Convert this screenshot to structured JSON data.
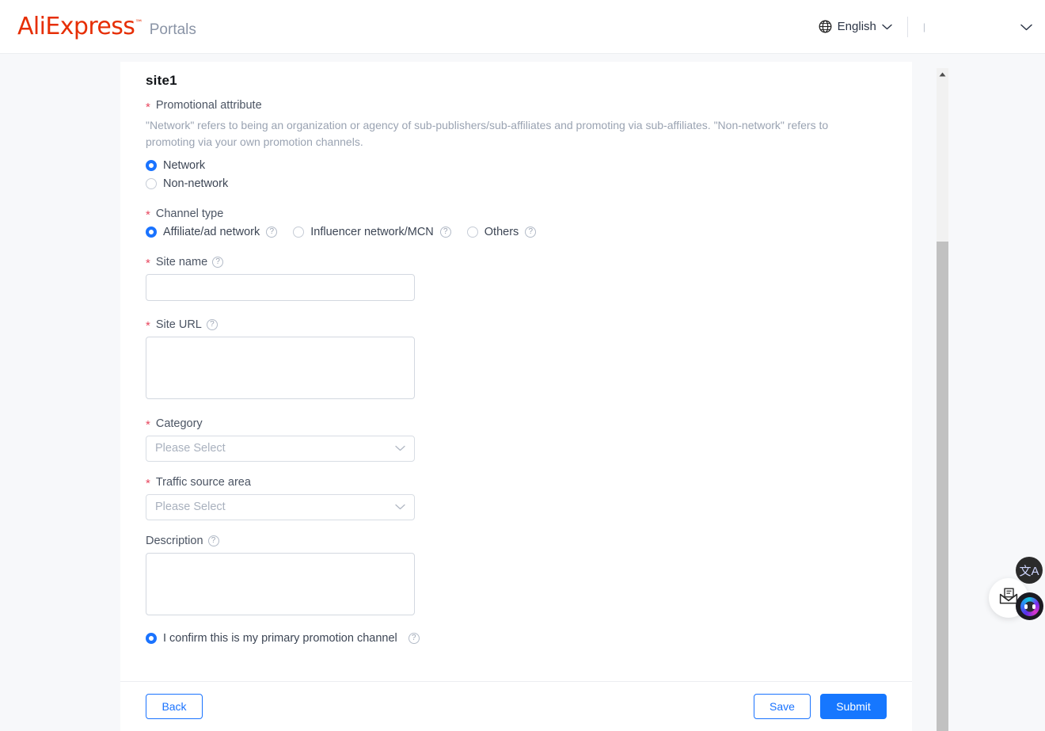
{
  "header": {
    "brand_main": "AliExpress",
    "brand_tm": "™",
    "brand_sub": "Portals",
    "language": "English",
    "globe_icon": "globe-icon",
    "lang_chevron_icon": "chevron-down-icon",
    "account_stub": "|",
    "account_chevron_icon": "chevron-down-icon"
  },
  "form": {
    "site_title": "site1",
    "promotional_attribute": {
      "required_mark": "*",
      "label": "Promotional attribute",
      "description": "\"Network\" refers to being an organization or agency of sub-publishers/sub-affiliates and promoting via sub-affiliates. \"Non-network\" refers to promoting via your own promotion channels.",
      "options": [
        {
          "label": "Network",
          "selected": true
        },
        {
          "label": "Non-network",
          "selected": false
        }
      ]
    },
    "channel_type": {
      "required_mark": "*",
      "label": "Channel type",
      "options": [
        {
          "label": "Affiliate/ad network",
          "selected": true,
          "help": "?"
        },
        {
          "label": "Influencer network/MCN",
          "selected": false,
          "help": "?"
        },
        {
          "label": "Others",
          "selected": false,
          "help": "?"
        }
      ]
    },
    "site_name": {
      "required_mark": "*",
      "label": "Site name",
      "help": "?",
      "value": "",
      "placeholder": ""
    },
    "site_url": {
      "required_mark": "*",
      "label": "Site URL",
      "help": "?",
      "value": "",
      "placeholder": ""
    },
    "category": {
      "required_mark": "*",
      "label": "Category",
      "selected": "Please Select",
      "chevron_icon": "chevron-down-icon"
    },
    "traffic_source_area": {
      "required_mark": "*",
      "label": "Traffic source area",
      "selected": "Please Select",
      "chevron_icon": "chevron-down-icon"
    },
    "description": {
      "label": "Description",
      "help": "?",
      "value": "",
      "placeholder": ""
    },
    "confirm": {
      "label": "I confirm this is my primary promotion channel",
      "selected": true,
      "help": "?"
    }
  },
  "footer": {
    "back_label": "Back",
    "save_label": "Save",
    "submit_label": "Submit"
  },
  "widgets": {
    "translate_glyph": "文A",
    "mail_icon": "envelope-icon",
    "chat_icon": "chat-avatar-icon"
  },
  "colors": {
    "brand": "#e62e04",
    "accent": "#1677ff",
    "required": "#e8475f",
    "page_bg": "#f7f8fa"
  }
}
